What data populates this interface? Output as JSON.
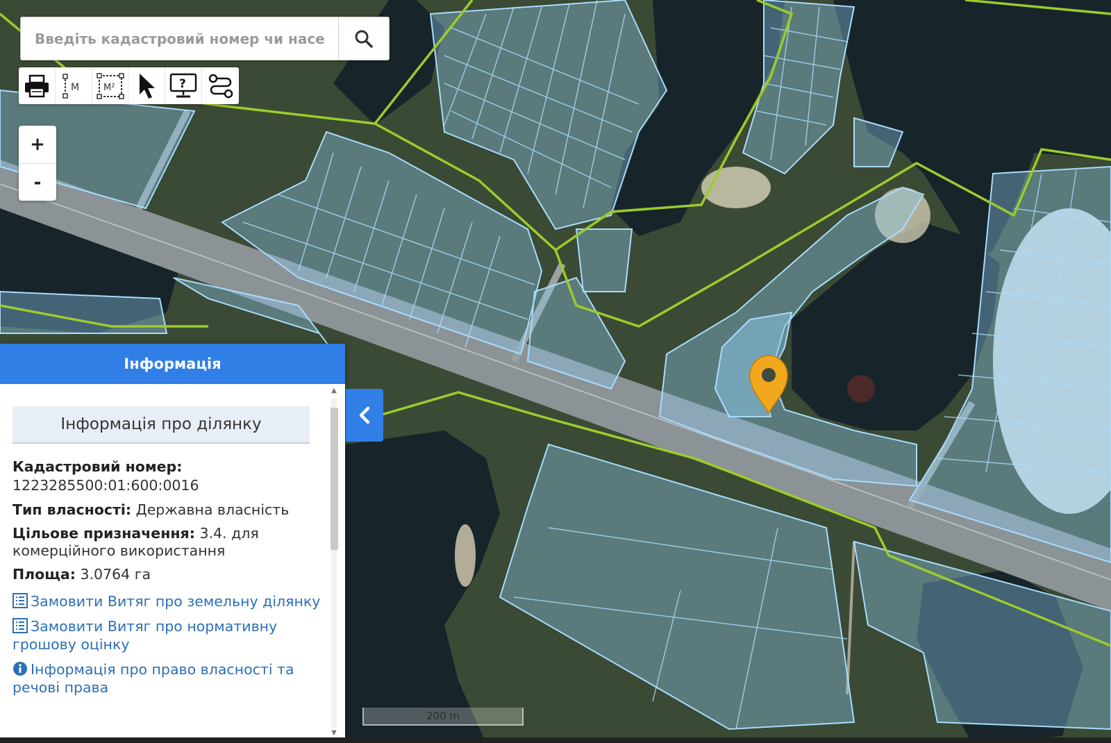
{
  "search": {
    "placeholder": "Введіть кадастровий номер чи населе",
    "icon": "search-icon"
  },
  "toolbar": {
    "items": [
      {
        "name": "print-icon"
      },
      {
        "name": "measure-length-icon",
        "label": "M"
      },
      {
        "name": "measure-area-icon",
        "label": "M²"
      },
      {
        "name": "select-pointer-icon"
      },
      {
        "name": "info-monitor-icon",
        "label": "?"
      },
      {
        "name": "route-icon"
      }
    ]
  },
  "zoom": {
    "in": "+",
    "out": "-"
  },
  "panel": {
    "header": "Інформація",
    "section_title": "Інформація про ділянку",
    "cadastral_label": "Кадастровий номер:",
    "cadastral_value": "1223285500:01:600:0016",
    "ownership_label": "Тип власності:",
    "ownership_value": "Державна власність",
    "purpose_label": "Цільове призначення:",
    "purpose_value": "3.4. для комерційного використання",
    "area_label": "Площа:",
    "area_value": "3.0764 га",
    "links": [
      {
        "text": "Замовити Витяг про земельну ділянку",
        "icon": "document-list-icon"
      },
      {
        "text": "Замовити Витяг про нормативну грошову оцінку",
        "icon": "document-list-icon"
      },
      {
        "text": "Інформація про право власності та речові права",
        "icon": "info-circle-icon"
      }
    ]
  },
  "scale": {
    "label": "200 m"
  },
  "colors": {
    "accent": "#2f7fe6",
    "parcel_fill": "#8ecbf0",
    "parcel_stroke": "#a9dcff",
    "boundary": "#9ccc2c",
    "marker": "#f2a81d",
    "link": "#2c6fb8",
    "water": "#17252a",
    "vegetation": "#3d5232"
  }
}
